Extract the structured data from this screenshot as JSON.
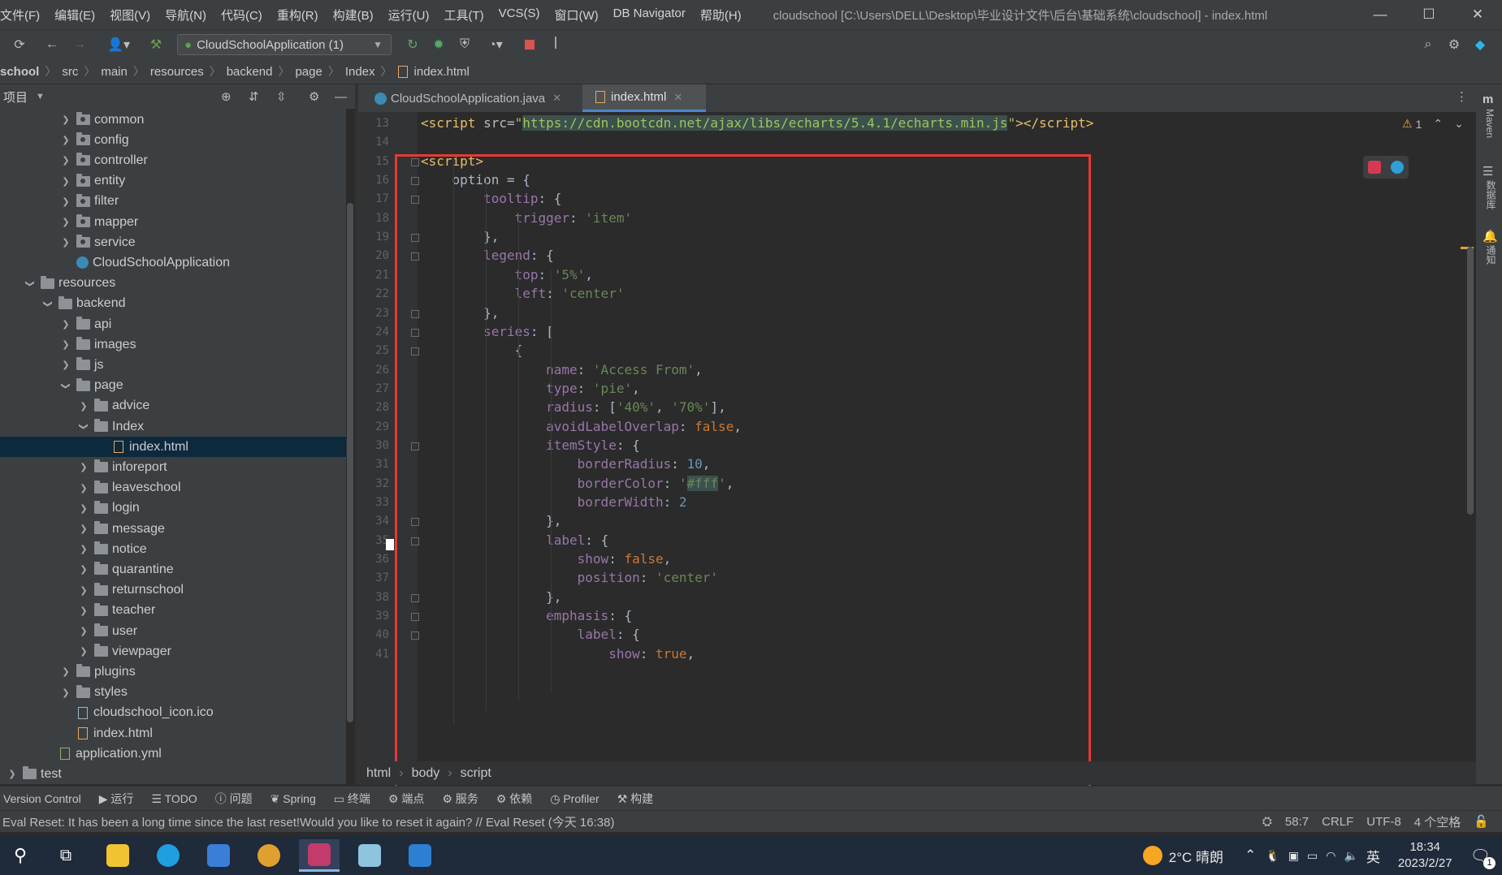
{
  "menu": [
    "文件(F)",
    "编辑(E)",
    "视图(V)",
    "导航(N)",
    "代码(C)",
    "重构(R)",
    "构建(B)",
    "运行(U)",
    "工具(T)",
    "VCS(S)",
    "窗口(W)",
    "DB Navigator",
    "帮助(H)"
  ],
  "window_title": "cloudschool [C:\\Users\\DELL\\Desktop\\毕业设计文件\\后台\\基础系统\\cloudschool] - index.html",
  "run_config": "CloudSchoolApplication (1)",
  "breadcrumb": [
    "school",
    "src",
    "main",
    "resources",
    "backend",
    "page",
    "Index",
    "index.html"
  ],
  "project_label": "项目",
  "tree": [
    {
      "label": "common",
      "depth": 4,
      "kind": "package",
      "arrow": "›"
    },
    {
      "label": "config",
      "depth": 4,
      "kind": "package",
      "arrow": "›"
    },
    {
      "label": "controller",
      "depth": 4,
      "kind": "package",
      "arrow": "›"
    },
    {
      "label": "entity",
      "depth": 4,
      "kind": "package",
      "arrow": "›"
    },
    {
      "label": "filter",
      "depth": 4,
      "kind": "package",
      "arrow": "›"
    },
    {
      "label": "mapper",
      "depth": 4,
      "kind": "package",
      "arrow": "›"
    },
    {
      "label": "service",
      "depth": 4,
      "kind": "package",
      "arrow": "›"
    },
    {
      "label": "CloudSchoolApplication",
      "depth": 4,
      "kind": "app",
      "arrow": ""
    },
    {
      "label": "resources",
      "depth": 2,
      "kind": "res",
      "arrow": "⌄"
    },
    {
      "label": "backend",
      "depth": 3,
      "kind": "folder",
      "arrow": "⌄"
    },
    {
      "label": "api",
      "depth": 4,
      "kind": "folder",
      "arrow": "›"
    },
    {
      "label": "images",
      "depth": 4,
      "kind": "folder",
      "arrow": "›"
    },
    {
      "label": "js",
      "depth": 4,
      "kind": "folder",
      "arrow": "›"
    },
    {
      "label": "page",
      "depth": 4,
      "kind": "folder",
      "arrow": "⌄"
    },
    {
      "label": "advice",
      "depth": 5,
      "kind": "folder",
      "arrow": "›"
    },
    {
      "label": "Index",
      "depth": 5,
      "kind": "folder",
      "arrow": "⌄"
    },
    {
      "label": "index.html",
      "depth": 6,
      "kind": "html",
      "arrow": "",
      "selected": true
    },
    {
      "label": "inforeport",
      "depth": 5,
      "kind": "folder",
      "arrow": "›"
    },
    {
      "label": "leaveschool",
      "depth": 5,
      "kind": "folder",
      "arrow": "›"
    },
    {
      "label": "login",
      "depth": 5,
      "kind": "folder",
      "arrow": "›"
    },
    {
      "label": "message",
      "depth": 5,
      "kind": "folder",
      "arrow": "›"
    },
    {
      "label": "notice",
      "depth": 5,
      "kind": "folder",
      "arrow": "›"
    },
    {
      "label": "quarantine",
      "depth": 5,
      "kind": "folder",
      "arrow": "›"
    },
    {
      "label": "returnschool",
      "depth": 5,
      "kind": "folder",
      "arrow": "›"
    },
    {
      "label": "teacher",
      "depth": 5,
      "kind": "folder",
      "arrow": "›"
    },
    {
      "label": "user",
      "depth": 5,
      "kind": "folder",
      "arrow": "›"
    },
    {
      "label": "viewpager",
      "depth": 5,
      "kind": "folder",
      "arrow": "›"
    },
    {
      "label": "plugins",
      "depth": 4,
      "kind": "folder",
      "arrow": "›"
    },
    {
      "label": "styles",
      "depth": 4,
      "kind": "folder",
      "arrow": "›"
    },
    {
      "label": "cloudschool_icon.ico",
      "depth": 4,
      "kind": "file",
      "arrow": ""
    },
    {
      "label": "index.html",
      "depth": 4,
      "kind": "html",
      "arrow": ""
    },
    {
      "label": "application.yml",
      "depth": 3,
      "kind": "yml",
      "arrow": ""
    },
    {
      "label": "test",
      "depth": 1,
      "kind": "folder",
      "arrow": "›"
    }
  ],
  "tabs": [
    {
      "label": "CloudSchoolApplication.java",
      "active": false
    },
    {
      "label": "index.html",
      "active": true
    }
  ],
  "code": [
    {
      "n": "13",
      "html": "<span class='t'>&lt;script </span><span class='attr'>src=</span><span class='str'>\"<span class='hl'>https://cdn.bootcdn.net/ajax/libs/echarts/5.4.1/echarts.min.js</span>\"</span><span class='t'>&gt;&lt;/script&gt;</span>"
    },
    {
      "n": "14",
      "html": ""
    },
    {
      "n": "15",
      "html": "<span class='t'>&lt;script&gt;</span>"
    },
    {
      "n": "16",
      "html": "    option = {"
    },
    {
      "n": "17",
      "html": "        <span class='p'>tooltip</span>: {"
    },
    {
      "n": "18",
      "html": "            <span class='p'>trigger</span>: <span class='s'>'item'</span>"
    },
    {
      "n": "19",
      "html": "        },"
    },
    {
      "n": "20",
      "html": "        <span class='p'>legend</span>: {"
    },
    {
      "n": "21",
      "html": "            <span class='p'>top</span>: <span class='s'>'5%'</span>,"
    },
    {
      "n": "22",
      "html": "            <span class='p'>left</span>: <span class='s'>'center'</span>"
    },
    {
      "n": "23",
      "html": "        },"
    },
    {
      "n": "24",
      "html": "        <span class='p'>series</span>: ["
    },
    {
      "n": "25",
      "html": "            {"
    },
    {
      "n": "26",
      "html": "                <span class='p'>name</span>: <span class='s'>'Access From'</span>,"
    },
    {
      "n": "27",
      "html": "                <span class='p'>type</span>: <span class='s'>'pie'</span>,"
    },
    {
      "n": "28",
      "html": "                <span class='p'>radius</span>: [<span class='s'>'40%'</span>, <span class='s'>'70%'</span>],"
    },
    {
      "n": "29",
      "html": "                <span class='p'>avoidLabelOverlap</span>: <span class='k'>false</span>,"
    },
    {
      "n": "30",
      "html": "                <span class='p'>itemStyle</span>: {"
    },
    {
      "n": "31",
      "html": "                    <span class='p'>borderRadius</span>: <span class='n'>10</span>,"
    },
    {
      "n": "32",
      "html": "                    <span class='p'>borderColor</span>: <span class='s'>'<span class='hl'>#fff</span>'</span>,"
    },
    {
      "n": "33",
      "html": "                    <span class='p'>borderWidth</span>: <span class='n'>2</span>"
    },
    {
      "n": "34",
      "html": "                },"
    },
    {
      "n": "35",
      "html": "                <span class='p'>label</span>: {"
    },
    {
      "n": "36",
      "html": "                    <span class='p'>show</span>: <span class='k'>false</span>,"
    },
    {
      "n": "37",
      "html": "                    <span class='p'>position</span>: <span class='s'>'center'</span>"
    },
    {
      "n": "38",
      "html": "                },"
    },
    {
      "n": "39",
      "html": "                <span class='p'>emphasis</span>: {"
    },
    {
      "n": "40",
      "html": "                    <span class='p'>label</span>: {"
    },
    {
      "n": "41",
      "html": "                        <span class='p'>show</span>: <span class='k'>true</span>,"
    }
  ],
  "warnings": "1",
  "nav_path": [
    "html",
    "body",
    "script"
  ],
  "tool_windows": [
    "Version Control",
    "运行",
    "TODO",
    "问题",
    "Spring",
    "终端",
    "端点",
    "服务",
    "依赖",
    "Profiler",
    "构建"
  ],
  "status_message": "Eval Reset: It has been a long time since the last reset!Would you like to reset it again? // Eval Reset (今天 16:38)",
  "status_right": [
    "58:7",
    "CRLF",
    "UTF-8",
    "4 个空格"
  ],
  "right_strip": [
    "Maven",
    "数据库",
    "通知"
  ],
  "weather": "2°C 晴朗",
  "ime": "英",
  "time": "18:34",
  "date": "2023/2/27",
  "notif_count": "1"
}
